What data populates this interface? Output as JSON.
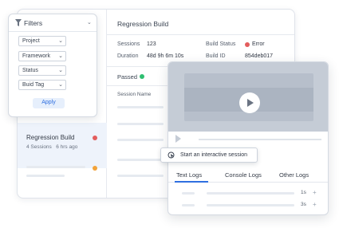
{
  "filters": {
    "title": "Filters",
    "selects": [
      {
        "label": "Project"
      },
      {
        "label": "Framework"
      },
      {
        "label": "Status"
      },
      {
        "label": "Buid Tag"
      }
    ],
    "apply_label": "Apply"
  },
  "build_list": {
    "selected": {
      "name": "Regression Build",
      "sessions": "4 Sessions",
      "age": "6 hrs ago",
      "status_color": "#e35d5d"
    },
    "status_colors": {
      "passed": "#2fbf71",
      "error": "#e35d5d",
      "running": "#f2a33a"
    }
  },
  "build_details": {
    "title": "Regression Build",
    "sessions_label": "Sessions",
    "sessions_value": "123",
    "duration_label": "Duration",
    "duration_value": "48d 9h 6m 10s",
    "status_label": "Build Status",
    "status_value": "Error",
    "id_label": "Build ID",
    "id_value": "854deb017",
    "passed_label": "Passed",
    "session_name_header": "Session Name"
  },
  "video_panel": {
    "interactive_session_label": "Start an interactive session",
    "tabs": [
      {
        "label": "Text Logs",
        "active": true
      },
      {
        "label": "Console Logs",
        "active": false
      },
      {
        "label": "Other Logs",
        "active": false
      }
    ],
    "logs": [
      {
        "time": "1s"
      },
      {
        "time": "3s"
      }
    ]
  }
}
